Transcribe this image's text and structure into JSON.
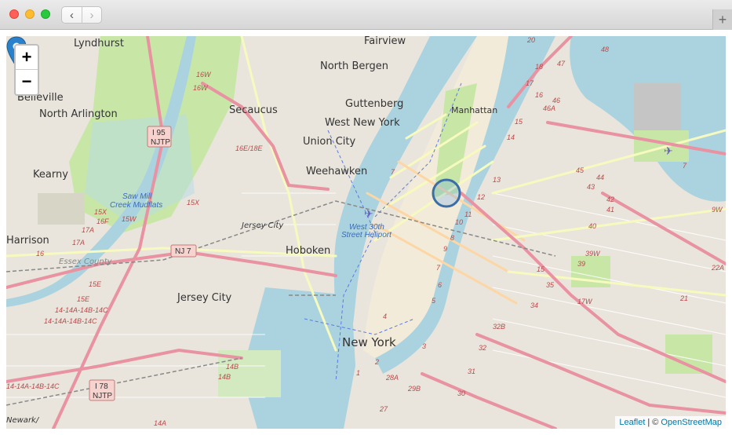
{
  "browser": {
    "back_label": "‹",
    "forward_label": "›",
    "new_tab_label": "+"
  },
  "map": {
    "zoom_in_label": "+",
    "zoom_out_label": "−",
    "attribution": {
      "leaflet": "Leaflet",
      "sep": "|",
      "copy": "©",
      "osm": "OpenStreetMap"
    },
    "marker_label": "New York",
    "places": {
      "lyndhurst": "Lyndhurst",
      "fairview": "Fairview",
      "north_bergen": "North Bergen",
      "belleville": "Belleville",
      "secaucus": "Secaucus",
      "guttenberg": "Guttenberg",
      "north_arlington": "North Arlington",
      "manhattan": "Manhattan",
      "west_new_york": "West New York",
      "union_city": "Union City",
      "kearny": "Kearny",
      "weehawken": "Weehawken",
      "saw_mill": "Saw Mill",
      "creek_mudflats": "Creek Mudflats",
      "jersey_city_small": "Jersey City",
      "west_30th": "West 30th",
      "street_heliport": "Street Heliport",
      "harrison": "Harrison",
      "hoboken": "Hoboken",
      "essex_county": "Essex County",
      "jersey_city": "Jersey City",
      "newark": "Newark/"
    },
    "shields": {
      "i95": "I 95",
      "njtp": "NJTP",
      "nj7": "NJ 7",
      "i78": "I 78",
      "njtp2": "NJTP"
    },
    "exits": {
      "e16w_a": "16W",
      "e16w_b": "16W",
      "e16e": "16E/18E",
      "e15x": "15X",
      "e16f": "16F",
      "e15x2": "15X",
      "e15w": "15W",
      "e17a": "17A",
      "e17a2": "17A",
      "e16": "16",
      "e15e": "15E",
      "e15e2": "15E",
      "e14c1": "14-14A-14B-14C",
      "e14c2": "14-14A-14B-14C",
      "e14c3": "14-14A-14B-14C",
      "e14b": "14B",
      "e14b2": "14B",
      "e14a": "14A",
      "e28a": "28A",
      "e29b": "29B",
      "e30": "30",
      "e31": "31",
      "e32": "32",
      "e32b": "32B",
      "e34": "34",
      "e35": "35",
      "e17w": "17W",
      "e39": "39",
      "e39w": "39W",
      "e40": "40",
      "e41": "41",
      "e42": "42",
      "e43": "43",
      "e44": "44",
      "e45": "45",
      "e46": "46",
      "e46a": "46A",
      "e47": "47",
      "e48": "48",
      "e20": "20",
      "e18": "18",
      "e17": "17",
      "e16b": "16",
      "e15": "15",
      "e14": "14",
      "e13": "13",
      "e12": "12",
      "e11": "11",
      "e10": "10",
      "e9": "9",
      "e8": "8",
      "e7": "7",
      "e7b": "7",
      "e6": "6",
      "e5": "5",
      "e4": "4",
      "e3": "3",
      "e2": "2",
      "e1": "1",
      "e27": "27",
      "e9w": "9W",
      "e22a": "22A",
      "e15b": "15",
      "e21": "21",
      "e7c": "7"
    }
  }
}
